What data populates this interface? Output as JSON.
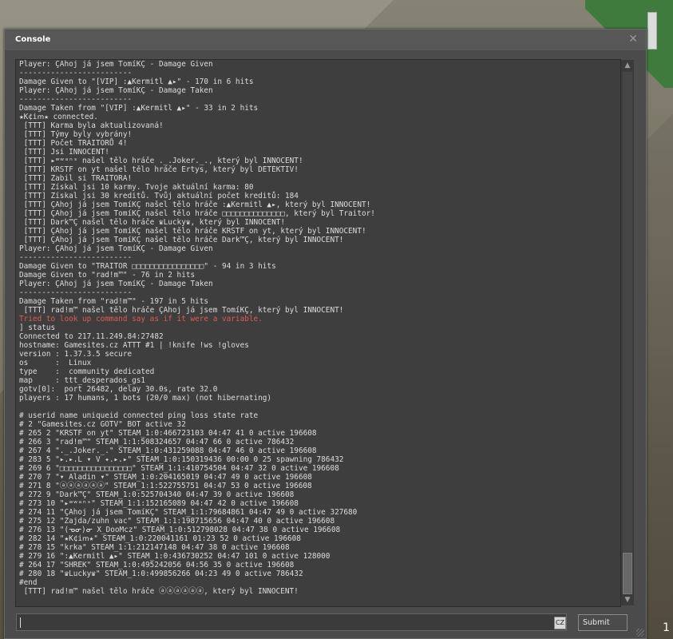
{
  "window": {
    "title": "Console"
  },
  "console_lines": [
    {
      "text": "Player: ÇAhoj já jsem TomíKÇ - Damage Given",
      "type": "normal"
    },
    {
      "text": "-------------------------",
      "type": "normal"
    },
    {
      "text": "Damage Given to \"[VIP] :▲Kermitl ▲▸\" - 170 in 6 hits",
      "type": "normal"
    },
    {
      "text": "Player: ÇAhoj já jsem TomíKÇ - Damage Taken",
      "type": "normal"
    },
    {
      "text": "-------------------------",
      "type": "normal"
    },
    {
      "text": "Damage Taken from \"[VIP] :▲Kermitl ▲▸\" - 33 in 2 hits",
      "type": "normal"
    },
    {
      "text": "★K¢iՠ★ connected.",
      "type": "normal"
    },
    {
      "text": " [TTT] Karma byla aktualizovaná!",
      "type": "normal"
    },
    {
      "text": " [TTT] Týmy byly vybrány!",
      "type": "normal"
    },
    {
      "text": " [TTT] Počet TRAITORŮ 4!",
      "type": "normal"
    },
    {
      "text": " [TTT] Jsi INNOCENT!",
      "type": "normal"
    },
    {
      "text": " [TTT] ▸ʷʷᵃⁿˢ našel tělo hráče ._.Joker._., který byl INNOCENT!",
      "type": "normal"
    },
    {
      "text": " [TTT] KRSTF on yt našel tělo hráče Ertys, který byl DETEKTIV!",
      "type": "normal"
    },
    {
      "text": " [TTT] Zabil si TRAITORA!",
      "type": "normal"
    },
    {
      "text": " [TTT] Získal jsi 10 karmy. Tvoje aktuální karma: 80",
      "type": "normal"
    },
    {
      "text": " [TTT] Získal jsi 30 kreditů. Tvůj aktuální počet kreditů: 184",
      "type": "normal"
    },
    {
      "text": " [TTT] ÇAhoj já jsem TomíKÇ našel tělo hráče :▲Kermitl ▲▸, který byl INNOCENT!",
      "type": "normal"
    },
    {
      "text": " [TTT] ÇAhoj já jsem TomíKÇ našel tělo hráče □□□□□□□□□□□□□□, který byl Traitor!",
      "type": "normal"
    },
    {
      "text": " [TTT] Dark™Ç našel tělo hráče ♛Lucky♛, který byl INNOCENT!",
      "type": "normal"
    },
    {
      "text": " [TTT] ÇAhoj já jsem TomíKÇ našel tělo hráče KRSTF on yt, který byl INNOCENT!",
      "type": "normal"
    },
    {
      "text": " [TTT] ÇAhoj já jsem TomíKÇ našel tělo hráče Dark™Ç, který byl INNOCENT!",
      "type": "normal"
    },
    {
      "text": "Player: ÇAhoj já jsem TomíKÇ - Damage Given",
      "type": "normal"
    },
    {
      "text": "-------------------------",
      "type": "normal"
    },
    {
      "text": "Damage Given to \"TRAITOR □□□□□□□□□□□□□□□□\" - 94 in 3 hits",
      "type": "normal"
    },
    {
      "text": "Damage Given to \"rad!m™\" - 76 in 2 hits",
      "type": "normal"
    },
    {
      "text": "Player: ÇAhoj já jsem TomíKÇ - Damage Taken",
      "type": "normal"
    },
    {
      "text": "-------------------------",
      "type": "normal"
    },
    {
      "text": "Damage Taken from \"rad!m™\" - 197 in 5 hits",
      "type": "normal"
    },
    {
      "text": " [TTT] rad!m™ našel tělo hráče ÇAhoj já jsem TomíKÇ, který byl INNOCENT!",
      "type": "normal"
    },
    {
      "text": "Tried to look up command say as if it were a variable.",
      "type": "error"
    },
    {
      "text": "] status",
      "type": "normal"
    },
    {
      "text": "Connected to 217.11.249.84:27482",
      "type": "normal"
    },
    {
      "text": "hostname: Gamesites.cz ATTT #1 | !knife !ws !gloves",
      "type": "normal"
    },
    {
      "text": "version : 1.37.3.5 secure",
      "type": "normal"
    },
    {
      "text": "os      :  Linux",
      "type": "normal"
    },
    {
      "text": "type    :  community dedicated",
      "type": "normal"
    },
    {
      "text": "map     : ttt_desperados_gs1",
      "type": "normal"
    },
    {
      "text": "gotv[0]:  port 26482, delay 30.0s, rate 32.0",
      "type": "normal"
    },
    {
      "text": "players : 17 humans, 1 bots (20/0 max) (not hibernating)",
      "type": "normal"
    },
    {
      "text": "",
      "type": "normal"
    },
    {
      "text": "# userid name uniqueid connected ping loss state rate",
      "type": "normal"
    },
    {
      "text": "# 2 \"Gamesites.cz GOTV\" BOT active 32",
      "type": "normal"
    },
    {
      "text": "# 265 2 \"KRSTF on yt\" STEAM_1:0:466723103 04:47 41 0 active 196608",
      "type": "normal"
    },
    {
      "text": "# 266 3 \"rad!m™\" STEAM_1:1:508324657 04:47 66 0 active 786432",
      "type": "normal"
    },
    {
      "text": "# 267 4 \"._.Joker._.\" STEAM_1:0:431259088 04:47 46 0 active 196608",
      "type": "normal"
    },
    {
      "text": "# 283 5 \"▸.▸.L ▾ V ✦.▸.▸\" STEAM_1:0:150319436 00:00 0 25 spawning 786432",
      "type": "normal"
    },
    {
      "text": "# 269 6 \"□□□□□□□□□□□□□□□□\" STEAM_1:1:410754504 04:47 32 0 active 196608",
      "type": "normal"
    },
    {
      "text": "# 270 7 \"▾ Aladin ▾\" STEAM_1:0:204165019 04:47 49 0 active 196608",
      "type": "normal"
    },
    {
      "text": "# 271 8 \"ⓐⓐⓐⓐⓐⓐ\" STEAM_1:1:522755751 04:47 53 0 active 196608",
      "type": "normal"
    },
    {
      "text": "# 272 9 \"Dark™Ç\" STEAM_1:0:525704340 04:47 39 0 active 196608",
      "type": "normal"
    },
    {
      "text": "# 273 10 \"▸ʷʷᵃⁿˢ\" STEAM_1:1:152165089 04:47 42 0 active 196608",
      "type": "normal"
    },
    {
      "text": "# 274 11 \"ÇAhoj já jsem TomíKÇ\" STEAM_1:1:79684861 04:47 49 0 active 327680",
      "type": "normal"
    },
    {
      "text": "# 275 12 \"Zajda/zuhn vac\" STEAM_1:1:198715656 04:47 40 0 active 196608",
      "type": "normal"
    },
    {
      "text": "# 276 13 \"(ᓀᓂ)ᓂ X_DooMcz\" STEAM_1:0:512798028 04:47 38 0 active 196608",
      "type": "normal"
    },
    {
      "text": "# 282 14 \"★K¢iՠ★\" STEAM_1:0:220041161 01:23 52 0 active 196608",
      "type": "normal"
    },
    {
      "text": "# 278 15 \"krka\" STEAM_1:1:212147148 04:47 38 0 active 196608",
      "type": "normal"
    },
    {
      "text": "# 279 16 \":▲Kermitl ▲▸\" STEAM_1:0:436730252 04:47 101 0 active 128000",
      "type": "normal"
    },
    {
      "text": "# 264 17 \"SHREK\" STEAM_1:0:495242056 04:56 35 0 active 196608",
      "type": "normal"
    },
    {
      "text": "# 280 18 \"♛Lucky♛\" STEAM_1:0:499856266 04:23 49 0 active 786432",
      "type": "normal"
    },
    {
      "text": "#end",
      "type": "normal"
    },
    {
      "text": " [TTT] rad!m™ našel tělo hráče ⓐⓐⓐⓐⓐⓐ, který byl INNOCENT!",
      "type": "normal"
    }
  ],
  "input": {
    "value": "",
    "language": "CZ"
  },
  "submit": {
    "label": "Submit"
  },
  "corner_number": "1",
  "colors": {
    "log_text": "#dcdcdc",
    "error_text": "#e05a4e",
    "window_bg": "#4b4b4b"
  }
}
